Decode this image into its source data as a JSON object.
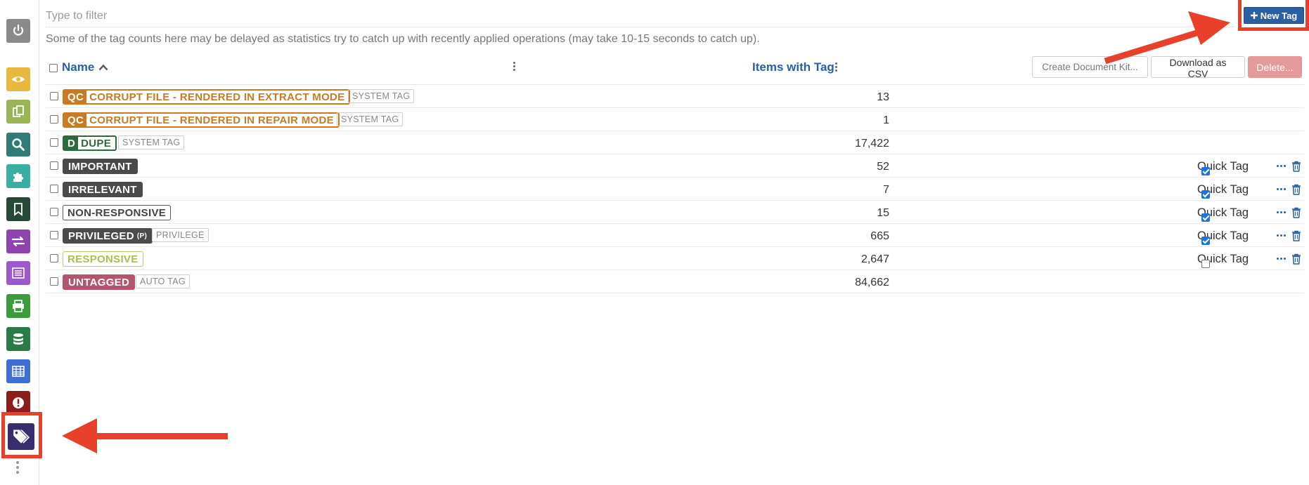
{
  "filter": {
    "placeholder": "Type to filter"
  },
  "notice": "Some of the tag counts here may be delayed as statistics try to catch up with recently applied operations (may take 10-15 seconds to catch up).",
  "new_tag_label": "New Tag",
  "columns": {
    "name": "Name",
    "items_with_tag": "Items with Tag"
  },
  "actions": {
    "create_kit": "Create Document Kit...",
    "download_csv": "Download as CSV",
    "delete": "Delete..."
  },
  "quick_tag_label": "Quick Tag",
  "rows": [
    {
      "prefix": "QC",
      "name": "CORRUPT FILE - RENDERED IN EXTRACT MODE",
      "badge": "SYSTEM TAG",
      "count": "13"
    },
    {
      "prefix": "QC",
      "name": "CORRUPT FILE - RENDERED IN REPAIR MODE",
      "badge": "SYSTEM TAG",
      "count": "1"
    },
    {
      "prefix": "D",
      "name": "DUPE",
      "badge": "SYSTEM TAG",
      "count": "17,422"
    },
    {
      "name": "IMPORTANT",
      "count": "52",
      "quick_tag": true
    },
    {
      "name": "IRRELEVANT",
      "count": "7",
      "quick_tag": true
    },
    {
      "name": "NON-RESPONSIVE",
      "count": "15",
      "quick_tag": true
    },
    {
      "name": "PRIVILEGED",
      "suffix": "(P)",
      "badge": "PRIVILEGE",
      "count": "665",
      "quick_tag": true
    },
    {
      "name": "RESPONSIVE",
      "count": "2,647",
      "quick_tag": false
    },
    {
      "name": "UNTAGGED",
      "badge": "AUTO TAG",
      "count": "84,662"
    }
  ],
  "sidebar": {
    "colors": {
      "power": "#8a8a8a",
      "eye": "#e9b93e",
      "docs": "#9bb556",
      "search": "#2f7d76",
      "puzzle": "#3aaea0",
      "bookmark": "#274737",
      "transfer": "#8e44ad",
      "list": "#9b59c9",
      "print": "#3e9a3e",
      "database": "#2c7a4a",
      "table": "#3f6fd6",
      "alert": "#8c1b1b",
      "tags": "#3a2d6e"
    }
  },
  "accent": "#2b5fa4",
  "annotation_color": "#e8402a"
}
